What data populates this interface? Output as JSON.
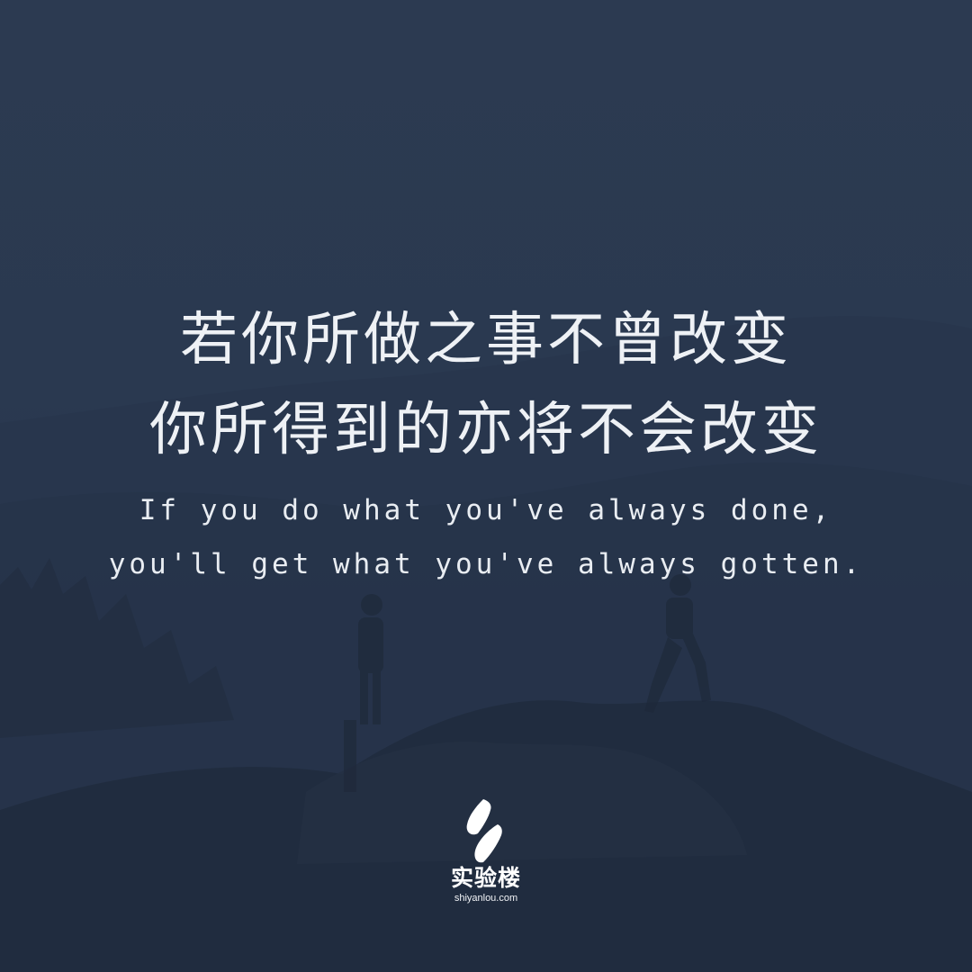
{
  "quote": {
    "chinese_line_1": "若你所做之事不曾改变",
    "chinese_line_2": "你所得到的亦将不会改变",
    "english_line_1": "If you do what you've always done,",
    "english_line_2": "you'll get what you've always gotten."
  },
  "brand": {
    "name": "实验楼",
    "url": "shiyanlou.com",
    "logo": "shiyanlou-logo-icon"
  },
  "colors": {
    "overlay": "#2a3950",
    "text": "#eef1f5"
  }
}
